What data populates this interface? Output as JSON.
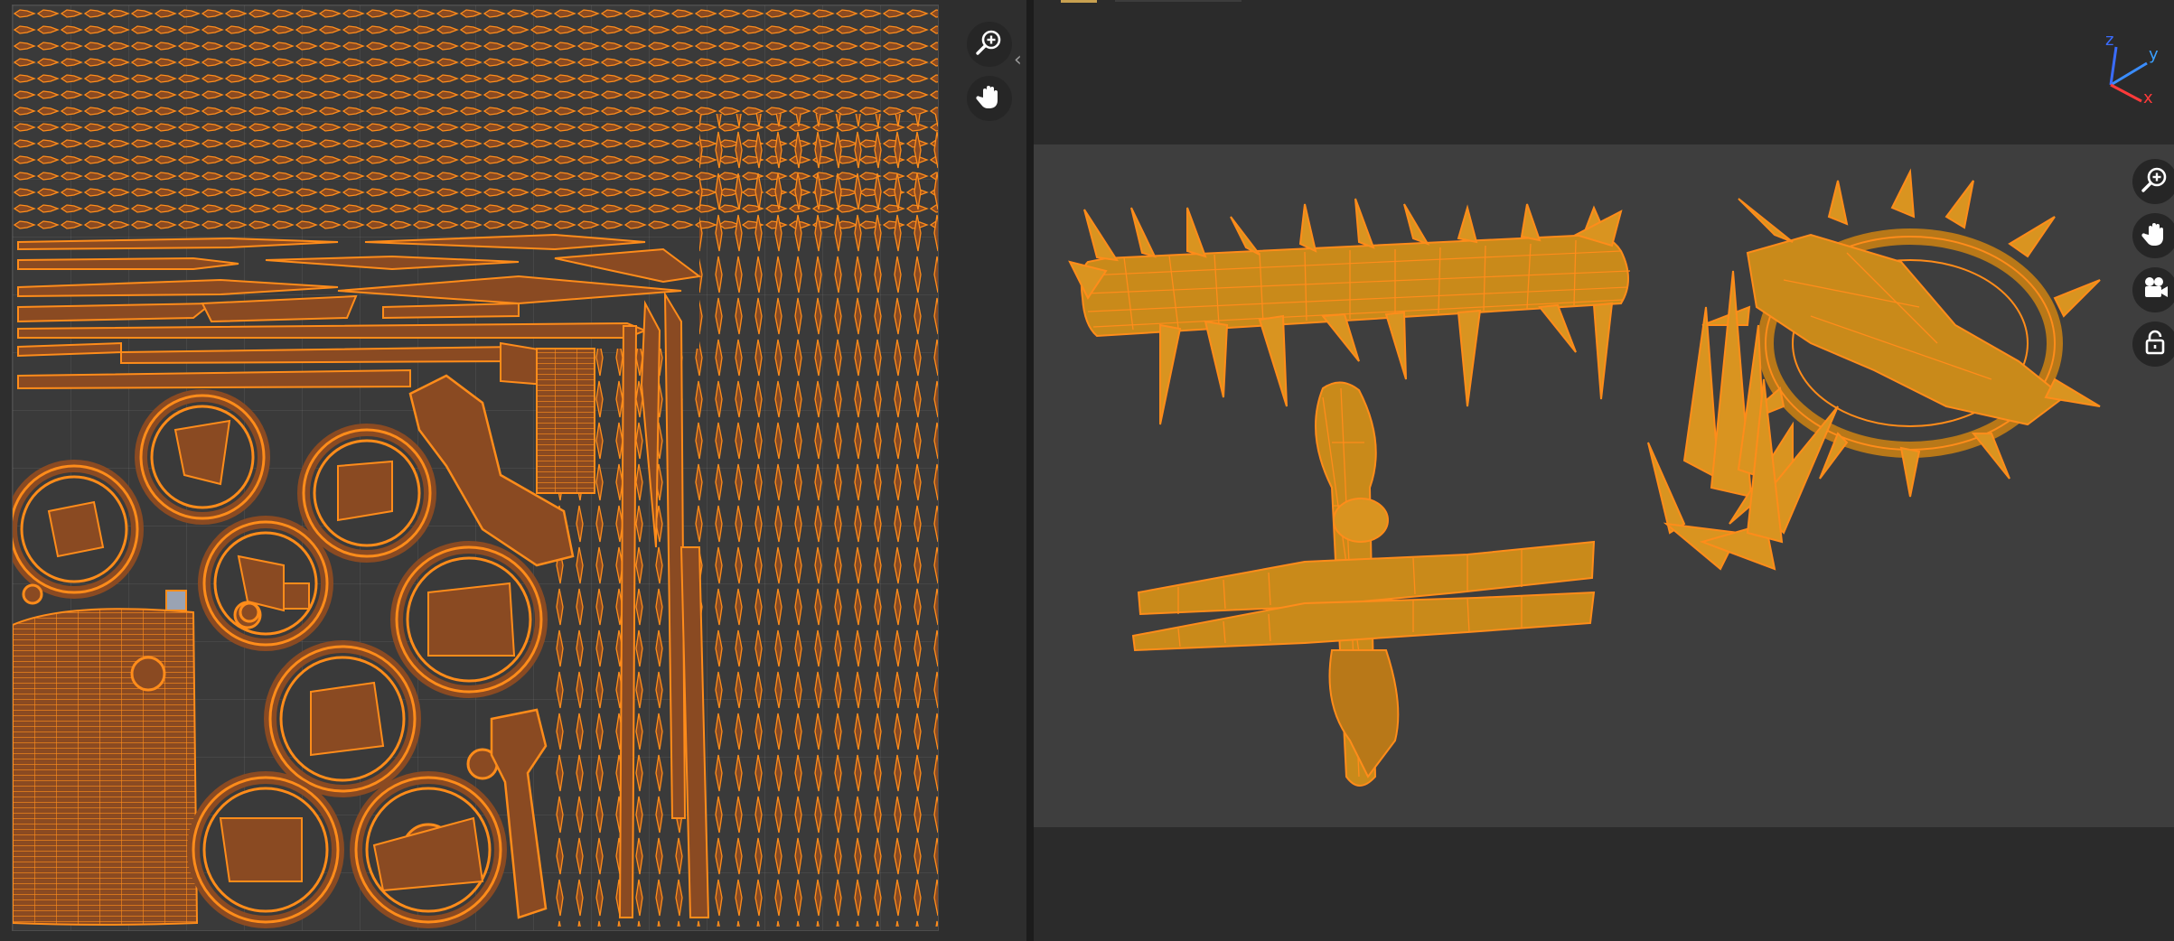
{
  "uv_editor": {
    "tools": [
      {
        "name": "zoom-tool",
        "icon": "zoom-in-icon"
      },
      {
        "name": "pan-tool",
        "icon": "hand-icon"
      }
    ],
    "collapse_left": "‹",
    "collapse_right": "›"
  },
  "viewport": {
    "gizmo": {
      "x_label": "x",
      "y_label": "y",
      "z_label": "z"
    },
    "tools": [
      {
        "name": "zoom-tool",
        "icon": "zoom-in-icon"
      },
      {
        "name": "pan-tool",
        "icon": "hand-icon"
      },
      {
        "name": "camera-tool",
        "icon": "camera-icon"
      },
      {
        "name": "lock-tool",
        "icon": "unlock-icon"
      }
    ],
    "objects": [
      "spiked-log",
      "crossed-wooden-stakes",
      "thorn-crown",
      "thorn-spikes"
    ]
  },
  "colors": {
    "accent": "#ff8c1a",
    "uv_fill": "#8a4a22",
    "mesh_fill": "#c98a1a",
    "background": "#2b2b2b"
  }
}
